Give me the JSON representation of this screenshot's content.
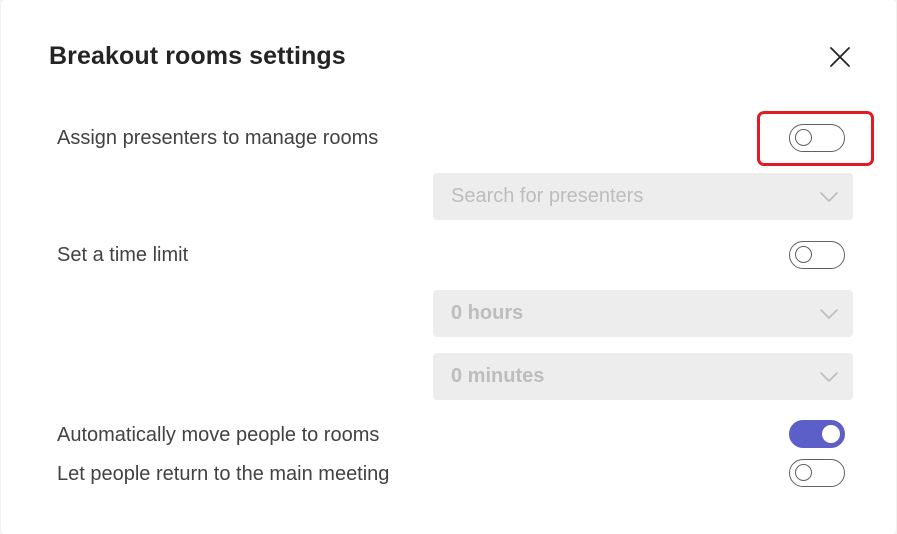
{
  "dialog": {
    "title": "Breakout rooms settings",
    "close_icon": "close-icon"
  },
  "settings": {
    "assign_presenters": {
      "label": "Assign presenters to manage rooms",
      "enabled": false,
      "highlighted": true,
      "highlight_color": "#e01b24"
    },
    "presenters_search": {
      "placeholder": "Search for presenters",
      "disabled": true
    },
    "time_limit": {
      "label": "Set a time limit",
      "enabled": false
    },
    "hours": {
      "value": "0 hours",
      "disabled": true
    },
    "minutes": {
      "value": "0 minutes",
      "disabled": true
    },
    "auto_move": {
      "label": "Automatically move people to rooms",
      "enabled": true
    },
    "return_main": {
      "label": "Let people return to the main meeting",
      "enabled": false
    }
  },
  "colors": {
    "toggle_on": "#5b5fc7",
    "disabled_field": "#ededed",
    "disabled_text": "#bdbdbd"
  }
}
